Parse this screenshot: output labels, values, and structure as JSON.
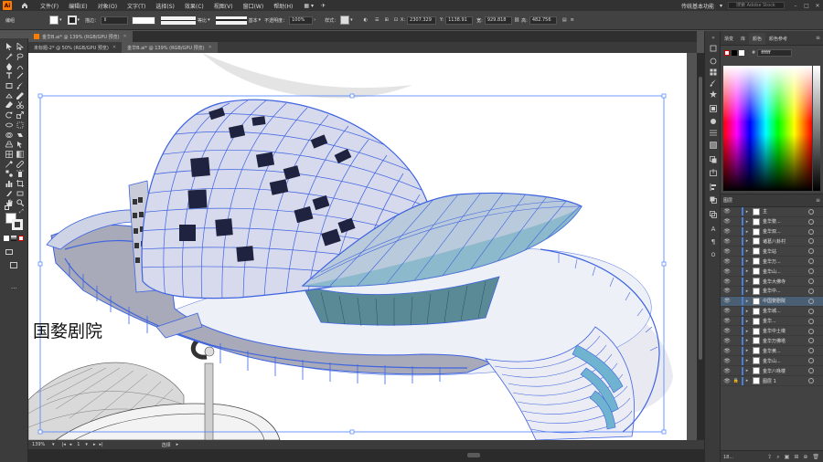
{
  "menubar": {
    "logo": "Ai",
    "items": [
      "文件(F)",
      "编辑(E)",
      "对象(O)",
      "文字(T)",
      "选择(S)",
      "效果(C)",
      "视图(V)",
      "窗口(W)",
      "帮助(H)"
    ],
    "workspace": "传统基本功能",
    "search_placeholder": "搜索 Adobe Stock"
  },
  "controlbar": {
    "selection_label": "编组",
    "stroke_label": "描边：",
    "stroke_profile": "等比",
    "brush": "基本",
    "opacity_label": "不透明度：",
    "opacity_value": "100%",
    "style_label": "样式：",
    "x_label": "X:",
    "x_value": "2307.329",
    "y_label": "Y:",
    "y_value": "1138.91",
    "w_label": "宽:",
    "w_value": "929.818",
    "h_label": "高:",
    "h_value": "482.756"
  },
  "doc_tabs": {
    "main": "金华B.ai* @ 139% (RGB/GPU 预览)",
    "tabs": [
      {
        "label": "未标题-2* @ 50% (RGB/GPU 预览)",
        "active": false
      },
      {
        "label": "金华B.ai* @ 139% (RGB/GPU 预览)",
        "active": true
      }
    ]
  },
  "canvas": {
    "building_title": "国婺剧院"
  },
  "status": {
    "zoom": "139%",
    "page": "1",
    "mode": "选择"
  },
  "color_panel": {
    "tabs": [
      "渐变",
      "库",
      "颜色",
      "颜色参考"
    ],
    "active_tab": "颜色",
    "hex": "ffffff"
  },
  "layers_panel": {
    "title": "图层",
    "layers": [
      {
        "name": "主",
        "lock": false,
        "selected": false
      },
      {
        "name": "金华婺...",
        "lock": false,
        "selected": false
      },
      {
        "name": "金华双...",
        "lock": false,
        "selected": false
      },
      {
        "name": "诸葛八卦村",
        "lock": false,
        "selected": false
      },
      {
        "name": "金华站",
        "lock": false,
        "selected": false
      },
      {
        "name": "金华万...",
        "lock": false,
        "selected": false
      },
      {
        "name": "金华山...",
        "lock": false,
        "selected": false
      },
      {
        "name": "金华大佛寺",
        "lock": false,
        "selected": false
      },
      {
        "name": "金华中...",
        "lock": false,
        "selected": false
      },
      {
        "name": "中国婺剧院",
        "lock": false,
        "selected": true
      },
      {
        "name": "金华城...",
        "lock": false,
        "selected": false
      },
      {
        "name": "金华...",
        "lock": false,
        "selected": false
      },
      {
        "name": "金华中土墩",
        "lock": false,
        "selected": false
      },
      {
        "name": "金华万佛塔",
        "lock": false,
        "selected": false
      },
      {
        "name": "金华黄...",
        "lock": false,
        "selected": false
      },
      {
        "name": "金华山...",
        "lock": false,
        "selected": false
      },
      {
        "name": "金华八咏楼",
        "lock": false,
        "selected": false
      },
      {
        "name": "图层 1",
        "lock": true,
        "selected": false
      }
    ],
    "count_label": "18..."
  }
}
